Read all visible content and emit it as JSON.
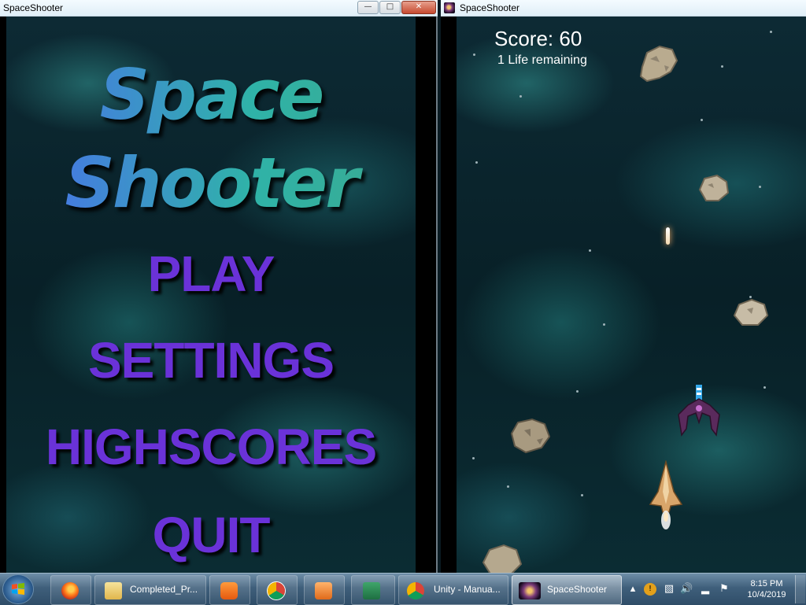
{
  "left_window": {
    "title": "SpaceShooter",
    "logo_line1": "Space",
    "logo_line2": "Shooter",
    "menu": [
      "PLAY",
      "SETTINGS",
      "HIGHSCORES",
      "QUIT"
    ]
  },
  "right_window": {
    "title": "SpaceShooter",
    "score": "Score: 60",
    "lives": "1 Life remaining"
  },
  "taskbar": {
    "items": [
      {
        "label": "",
        "icon": "firefox-icon"
      },
      {
        "label": "Completed_Pr...",
        "icon": "folder-icon"
      },
      {
        "label": "",
        "icon": "uc-browser-icon"
      },
      {
        "label": "",
        "icon": "chrome-icon"
      },
      {
        "label": "",
        "icon": "media-player-icon"
      },
      {
        "label": "",
        "icon": "excel-icon"
      },
      {
        "label": "Unity - Manua...",
        "icon": "chrome-icon"
      },
      {
        "label": "SpaceShooter",
        "icon": "spaceshooter-app-icon"
      }
    ],
    "clock_time": "8:15 PM",
    "clock_date": "10/4/2019"
  },
  "colors": {
    "menu_text": "#6a32d8",
    "logo_gradient_start": "#4b6cf0",
    "logo_gradient_end": "#3aa98f"
  }
}
